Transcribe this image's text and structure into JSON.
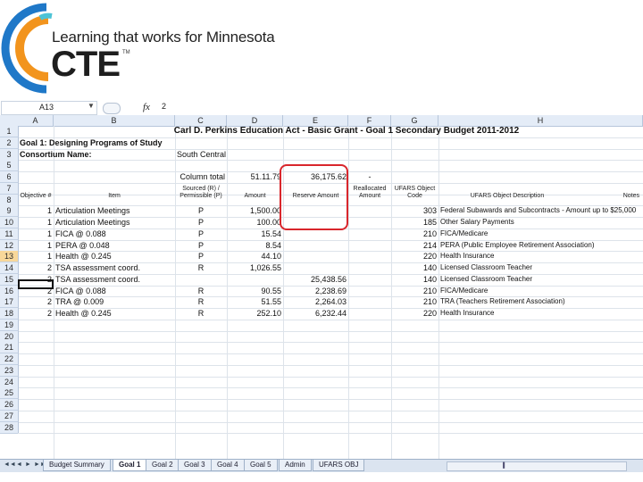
{
  "branding": {
    "tagline": "Learning that works for Minnesota",
    "logo_text": "CTE",
    "trademark": "TM",
    "colors": {
      "orange": "#f2941d",
      "blue": "#1f78c8",
      "teal": "#4dc3d6"
    }
  },
  "formula_bar": {
    "cell_ref": "A13",
    "fx": "fx",
    "value": "2"
  },
  "columns": [
    "A",
    "B",
    "C",
    "D",
    "E",
    "F",
    "G",
    "H"
  ],
  "rows": [
    "1",
    "2",
    "3",
    "5",
    "6",
    "7",
    "8",
    "9",
    "10",
    "11",
    "12",
    "13",
    "14",
    "15",
    "16",
    "17",
    "18",
    "19",
    "20",
    "21",
    "22",
    "23",
    "24",
    "25",
    "26",
    "27",
    "28"
  ],
  "sheet": {
    "title": "Carl D. Perkins Education Act - Basic Grant - Goal 1 Secondary Budget  2011-2012",
    "goal": "Goal 1: Designing Programs of Study",
    "consortium_label": "Consortium Name:",
    "consortium_value": "South Central",
    "column_total_label": "Column total",
    "column_total_d": "51.11.79",
    "column_total_e": "36,175.62",
    "column_total_f": "-",
    "headers": {
      "objective": "Objective #",
      "item": "Item",
      "sourced": "Sourced (R) / Permissible (P)",
      "amount": "Amount",
      "reserve": "Reserve Amount",
      "reallocated": "Reallocated Amount",
      "ufars": "UFARS Object Code",
      "ufars_desc": "UFARS Object Description",
      "notes": "Notes"
    },
    "data_rows": [
      {
        "obj": "1",
        "item": "Articulation Meetings",
        "rp": "P",
        "amount": "1,500.00",
        "reserve": "",
        "code": "303",
        "desc": "Federal Subawards and Subcontracts - Amount up to $25,000"
      },
      {
        "obj": "1",
        "item": "Articulation Meetings",
        "rp": "P",
        "amount": "100.00",
        "reserve": "",
        "code": "185",
        "desc": "Other Salary Payments"
      },
      {
        "obj": "1",
        "item": "FICA @ 0.088",
        "rp": "P",
        "amount": "15.54",
        "reserve": "",
        "code": "210",
        "desc": "FICA/Medicare"
      },
      {
        "obj": "1",
        "item": "PERA @ 0.048",
        "rp": "P",
        "amount": "8.54",
        "reserve": "",
        "code": "214",
        "desc": "PERA (Public Employee Retirement Association)"
      },
      {
        "obj": "1",
        "item": "Health @ 0.245",
        "rp": "P",
        "amount": "44.10",
        "reserve": "",
        "code": "220",
        "desc": "Health Insurance"
      },
      {
        "obj": "2",
        "item": "TSA assessment coord.",
        "rp": "R",
        "amount": "1,026.55",
        "reserve": "",
        "code": "140",
        "desc": "Licensed Classroom Teacher"
      },
      {
        "obj": "2",
        "item": "TSA assessment coord.",
        "rp": "",
        "amount": "",
        "reserve": "25,438.56",
        "code": "140",
        "desc": "Licensed Classroom Teacher"
      },
      {
        "obj": "2",
        "item": "FICA @ 0.088",
        "rp": "R",
        "amount": "90.55",
        "reserve": "2,238.69",
        "code": "210",
        "desc": "FICA/Medicare"
      },
      {
        "obj": "2",
        "item": "TRA @ 0.009",
        "rp": "R",
        "amount": "51.55",
        "reserve": "2,264.03",
        "code": "210",
        "desc": "TRA (Teachers Retirement Association)"
      },
      {
        "obj": "2",
        "item": "Health @ 0.245",
        "rp": "R",
        "amount": "252.10",
        "reserve": "6,232.44",
        "code": "220",
        "desc": "Health Insurance"
      }
    ]
  },
  "tabs": [
    "Budget Summary",
    "Goal 1",
    "Goal 2",
    "Goal 3",
    "Goal 4",
    "Goal 5",
    "Admin",
    "UFARS OBJ"
  ],
  "active_tab": "Goal 1",
  "nav_glyphs": [
    "◄◄",
    "◄",
    "►",
    "►►"
  ]
}
